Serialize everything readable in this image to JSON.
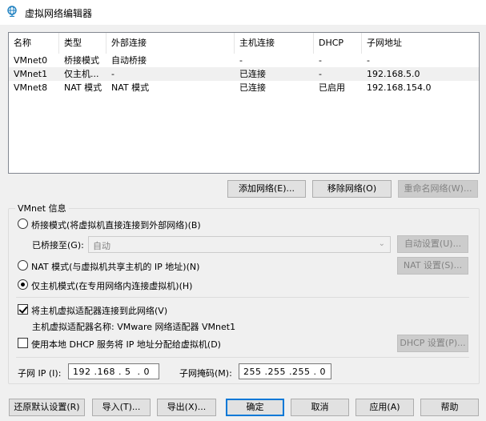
{
  "window": {
    "title": "虚拟网络编辑器"
  },
  "table": {
    "headers": [
      "名称",
      "类型",
      "外部连接",
      "主机连接",
      "DHCP",
      "子网地址"
    ],
    "rows": [
      [
        "VMnet0",
        "桥接模式",
        "自动桥接",
        "-",
        "-",
        "-"
      ],
      [
        "VMnet1",
        "仅主机...",
        "-",
        "已连接",
        "-",
        "192.168.5.0"
      ],
      [
        "VMnet8",
        "NAT 模式",
        "NAT 模式",
        "已连接",
        "已启用",
        "192.168.154.0"
      ]
    ],
    "selected_row": 1
  },
  "list_buttons": {
    "add": "添加网络(E)...",
    "remove": "移除网络(O)",
    "rename": "重命名网络(W)..."
  },
  "vmnet_info": {
    "legend": "VMnet 信息",
    "bridged_label": "桥接模式(将虚拟机直接连接到外部网络)(B)",
    "bridged_to_label": "已桥接至(G):",
    "bridged_to_value": "自动",
    "auto_settings": "自动设置(U)...",
    "nat_label": "NAT 模式(与虚拟机共享主机的 IP 地址)(N)",
    "nat_settings": "NAT 设置(S)...",
    "hostonly_label": "仅主机模式(在专用网络内连接虚拟机)(H)",
    "selected_mode": "hostonly",
    "connect_adapter_label": "将主机虚拟适配器连接到此网络(V)",
    "connect_adapter_checked": true,
    "adapter_name_text": "主机虚拟适配器名称: VMware 网络适配器 VMnet1",
    "dhcp_label": "使用本地 DHCP 服务将 IP 地址分配给虚拟机(D)",
    "dhcp_checked": false,
    "dhcp_settings": "DHCP 设置(P)...",
    "subnet_ip_label": "子网 IP (I):",
    "subnet_ip": "192 .168 . 5  . 0",
    "subnet_mask_label": "子网掩码(M):",
    "subnet_mask": "255 .255 .255 . 0"
  },
  "footer": {
    "restore": "还原默认设置(R)",
    "import": "导入(T)...",
    "export": "导出(X)...",
    "ok": "确定",
    "cancel": "取消",
    "apply": "应用(A)",
    "help": "帮助"
  },
  "colors": {
    "accent": "#0078d7",
    "selected_row": "#f0f0f0"
  },
  "icons": {
    "app": "globe-network-icon",
    "dropdown": "chevron-down-icon"
  }
}
